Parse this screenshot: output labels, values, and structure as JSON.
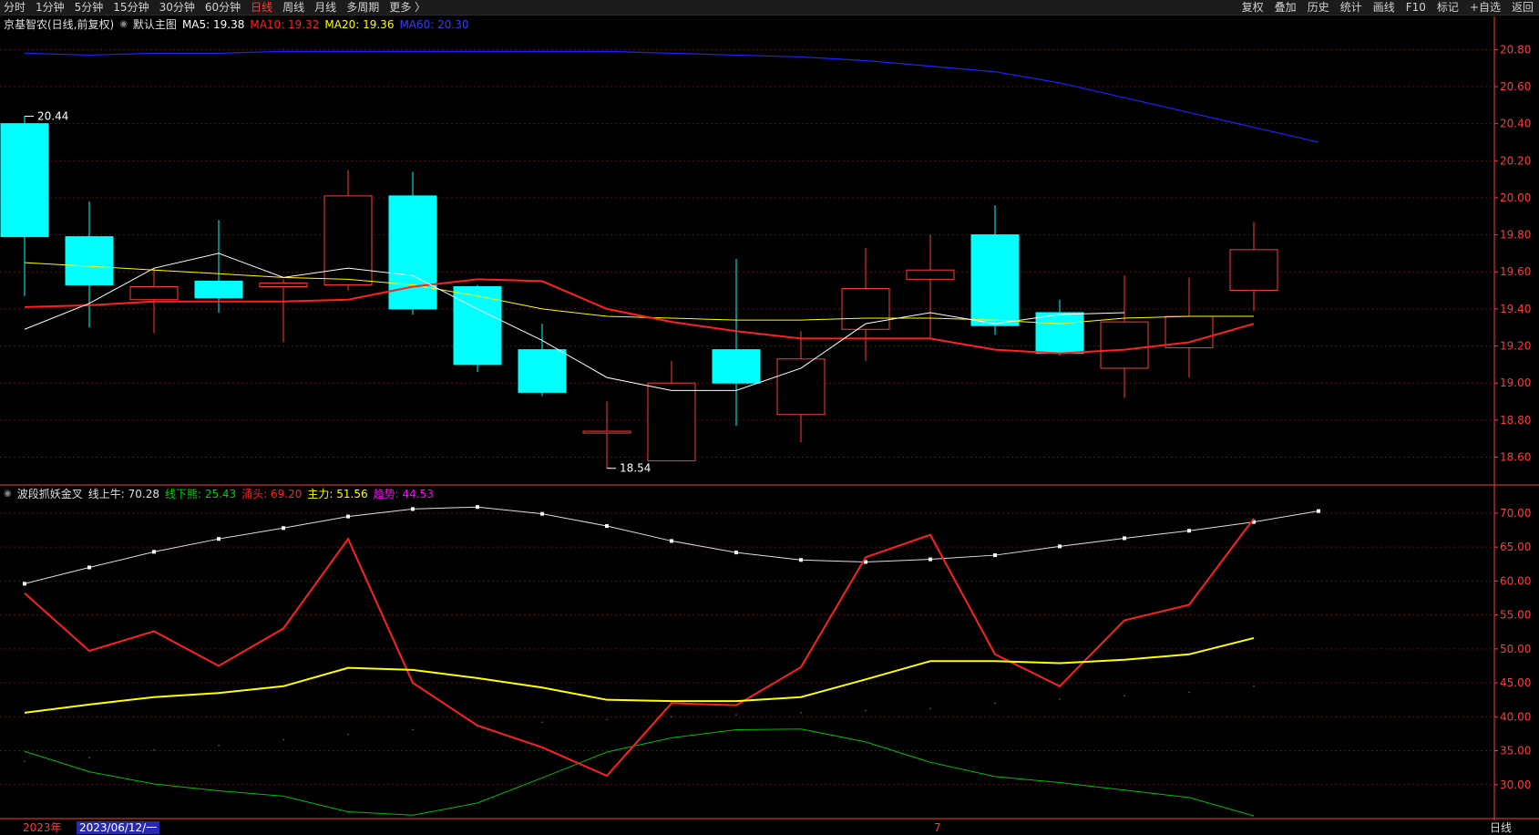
{
  "toolbar": {
    "left_items": [
      "分时",
      "1分钟",
      "5分钟",
      "15分钟",
      "30分钟",
      "60分钟",
      "日线",
      "周线",
      "月线",
      "多周期",
      "更多 〉"
    ],
    "active_item": "日线",
    "right_items": [
      "复权",
      "叠加",
      "历史",
      "统计",
      "画线",
      "F10",
      "标记",
      "+自选",
      "返回"
    ]
  },
  "main_header": {
    "stock_name": "京基智农(日线,前复权)",
    "indicator": "默认主图",
    "ma5": "MA5: 19.38",
    "ma10": "MA10: 19.32",
    "ma20": "MA20: 19.36",
    "ma60": "MA60: 20.30",
    "max_label": "20.44",
    "min_label": "18.54"
  },
  "sub_header": {
    "name": "波段抓妖金叉",
    "line1": "线上牛: 70.28",
    "line2": "线下熊: 25.43",
    "line3": "涌头: 69.20",
    "line4": "主力: 51.56",
    "line5": "趋势: 44.53"
  },
  "bottom": {
    "year": "2023年",
    "current_date": "2023/06/12/一",
    "month_mark": "7",
    "period": "日线"
  },
  "colors": {
    "up": "#ff3b3b",
    "down": "#00ffff",
    "ma5": "#ffffff",
    "ma10": "#ff2020",
    "ma20": "#ffff00",
    "ma60": "#2020ff",
    "bull": "#e0e0e0",
    "bear": "#00c000",
    "yongtou": "#ff2020",
    "zhuli": "#ffff00",
    "qushi": "#ff00ff",
    "axis": "#ff3b3b"
  },
  "chart_data": [
    {
      "type": "candlestick",
      "ylim": [
        18.45,
        20.9
      ],
      "yticks": [
        18.6,
        18.8,
        19.0,
        19.2,
        19.4,
        19.6,
        19.8,
        20.0,
        20.2,
        20.4,
        20.6,
        20.8
      ],
      "candles": [
        {
          "o": 20.4,
          "h": 20.44,
          "l": 19.47,
          "c": 19.79
        },
        {
          "o": 19.79,
          "h": 19.98,
          "l": 19.3,
          "c": 19.53
        },
        {
          "o": 19.45,
          "h": 19.62,
          "l": 19.27,
          "c": 19.52
        },
        {
          "o": 19.55,
          "h": 19.88,
          "l": 19.38,
          "c": 19.46
        },
        {
          "o": 19.52,
          "h": 19.56,
          "l": 19.22,
          "c": 19.54
        },
        {
          "o": 19.53,
          "h": 20.15,
          "l": 19.5,
          "c": 20.01
        },
        {
          "o": 20.01,
          "h": 20.14,
          "l": 19.37,
          "c": 19.4
        },
        {
          "o": 19.52,
          "h": 19.53,
          "l": 19.06,
          "c": 19.1
        },
        {
          "o": 19.18,
          "h": 19.32,
          "l": 18.93,
          "c": 18.95
        },
        {
          "o": 18.74,
          "h": 18.9,
          "l": 18.54,
          "c": 18.74
        },
        {
          "o": 18.58,
          "h": 19.12,
          "l": 18.58,
          "c": 19.0
        },
        {
          "o": 19.18,
          "h": 19.67,
          "l": 18.77,
          "c": 19.0
        },
        {
          "o": 18.83,
          "h": 19.28,
          "l": 18.68,
          "c": 19.13
        },
        {
          "o": 19.29,
          "h": 19.73,
          "l": 19.12,
          "c": 19.51
        },
        {
          "o": 19.56,
          "h": 19.8,
          "l": 19.24,
          "c": 19.61
        },
        {
          "o": 19.8,
          "h": 19.96,
          "l": 19.26,
          "c": 19.31
        },
        {
          "o": 19.38,
          "h": 19.45,
          "l": 19.15,
          "c": 19.16
        },
        {
          "o": 19.08,
          "h": 19.58,
          "l": 18.92,
          "c": 19.33
        },
        {
          "o": 19.19,
          "h": 19.57,
          "l": 19.03,
          "c": 19.36
        },
        {
          "o": 19.5,
          "h": 19.87,
          "l": 19.39,
          "c": 19.72
        }
      ],
      "ma5": [
        19.29,
        19.43,
        19.62,
        19.7,
        19.57,
        19.62,
        19.58,
        19.4,
        19.23,
        19.03,
        18.96,
        18.96,
        19.08,
        19.32,
        19.38,
        19.32,
        19.37,
        19.38
      ],
      "ma10": [
        19.41,
        19.42,
        19.44,
        19.44,
        19.44,
        19.45,
        19.52,
        19.56,
        19.55,
        19.4,
        19.33,
        19.28,
        19.24,
        19.24,
        19.24,
        19.18,
        19.16,
        19.18,
        19.22,
        19.32
      ],
      "ma20": [
        19.65,
        19.63,
        19.61,
        19.59,
        19.57,
        19.56,
        19.53,
        19.47,
        19.4,
        19.36,
        19.35,
        19.34,
        19.34,
        19.35,
        19.35,
        19.34,
        19.32,
        19.35,
        19.36,
        19.36
      ],
      "ma60": [
        20.78,
        20.77,
        20.78,
        20.78,
        20.79,
        20.79,
        20.79,
        20.79,
        20.79,
        20.79,
        20.78,
        20.77,
        20.76,
        20.74,
        20.71,
        20.68,
        20.62,
        20.54,
        20.46,
        20.38,
        20.3
      ]
    },
    {
      "type": "line",
      "ylim": [
        25,
        72
      ],
      "yticks": [
        30.0,
        35.0,
        40.0,
        45.0,
        50.0,
        55.0,
        60.0,
        65.0,
        70.0
      ],
      "series": [
        {
          "name": "线上牛",
          "values": [
            59.6,
            62.0,
            64.3,
            66.2,
            67.8,
            69.5,
            70.6,
            70.9,
            69.9,
            68.1,
            65.9,
            64.2,
            63.1,
            62.8,
            63.2,
            63.8,
            65.1,
            66.3,
            67.4,
            68.7,
            70.3
          ]
        },
        {
          "name": "线下熊",
          "values": [
            34.9,
            31.9,
            30.1,
            29.1,
            28.3,
            26.0,
            25.5,
            27.3,
            31.0,
            34.8,
            36.9,
            38.1,
            38.2,
            36.3,
            33.3,
            31.2,
            30.3,
            29.2,
            28.1,
            25.4
          ]
        },
        {
          "name": "涌头",
          "values": [
            58.2,
            49.7,
            52.6,
            47.5,
            53.0,
            66.2,
            45.0,
            38.7,
            35.5,
            31.3,
            42.0,
            41.7,
            47.3,
            63.5,
            66.8,
            49.2,
            44.5,
            54.2,
            56.5,
            69.2
          ]
        },
        {
          "name": "主力",
          "values": [
            40.6,
            41.8,
            42.9,
            43.5,
            44.5,
            47.2,
            46.9,
            45.7,
            44.3,
            42.5,
            42.3,
            42.3,
            42.9,
            45.5,
            48.2,
            48.2,
            47.9,
            48.4,
            49.2,
            51.6
          ]
        },
        {
          "name": "趋势",
          "values": [
            33.4,
            34.0,
            35.1,
            35.8,
            36.6,
            37.4,
            38.1,
            38.6,
            39.2,
            39.6,
            40.0,
            40.3,
            40.6,
            40.9,
            41.2,
            42.0,
            42.6,
            43.1,
            43.6,
            44.5
          ]
        }
      ]
    }
  ]
}
